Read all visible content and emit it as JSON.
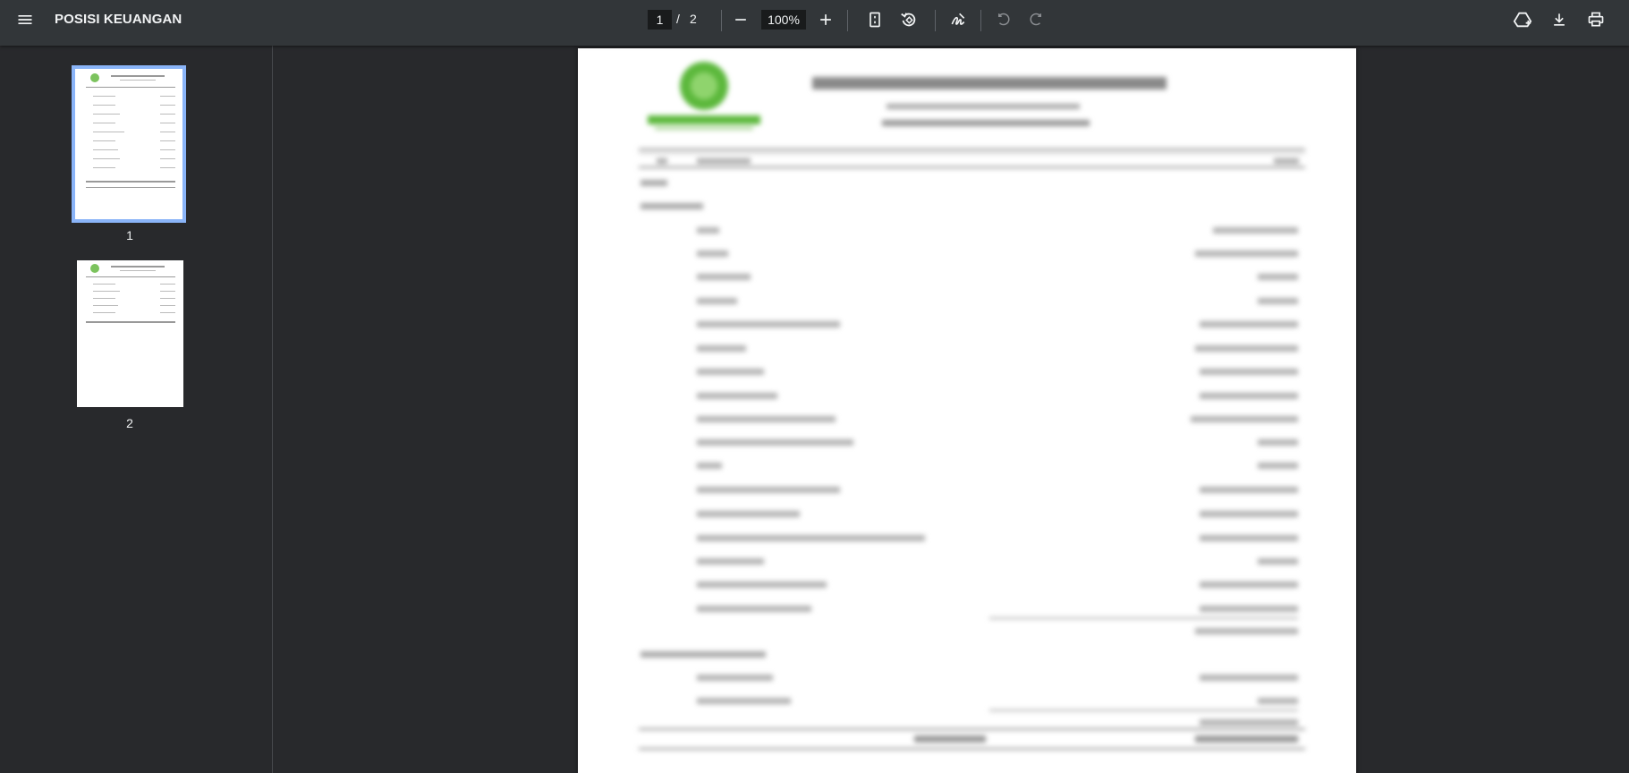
{
  "toolbar": {
    "title": "POSISI KEUANGAN",
    "current_page": "1",
    "page_separator": "/",
    "total_pages": "2",
    "zoom": "100%",
    "icons": {
      "menu": "menu-icon",
      "zoom_out": "minus-icon",
      "zoom_in": "plus-icon",
      "fit": "fit-page-icon",
      "rotate": "rotate-icon",
      "annotate": "pen-icon",
      "undo": "undo-icon",
      "redo": "redo-icon",
      "drive": "add-to-drive-icon",
      "download": "download-icon",
      "print": "print-icon"
    }
  },
  "sidebar": {
    "thumbnails": [
      {
        "label": "1",
        "selected": true
      },
      {
        "label": "2",
        "selected": false
      }
    ]
  },
  "colors": {
    "toolbar_bg": "#323639",
    "viewer_bg": "#28292c",
    "selected_outline": "#8ab4f8",
    "logo_green": "#5cb83c"
  }
}
